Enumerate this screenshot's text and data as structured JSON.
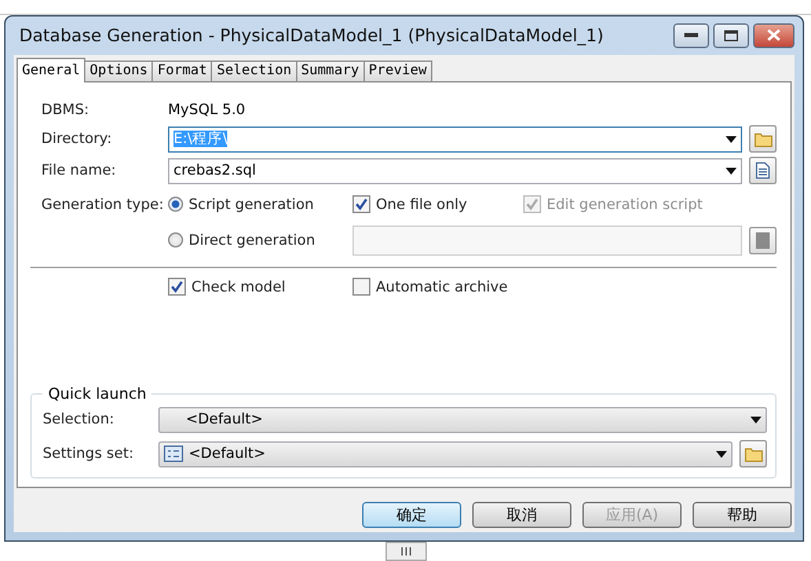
{
  "window": {
    "title": "Database Generation - PhysicalDataModel_1 (PhysicalDataModel_1)"
  },
  "tabs": [
    {
      "label": "General",
      "selected": true
    },
    {
      "label": "Options",
      "selected": false
    },
    {
      "label": "Format",
      "selected": false
    },
    {
      "label": "Selection",
      "selected": false
    },
    {
      "label": "Summary",
      "selected": false
    },
    {
      "label": "Preview",
      "selected": false
    }
  ],
  "dbms": {
    "label": "DBMS:",
    "value": "MySQL 5.0"
  },
  "directory": {
    "label": "Directory:",
    "value": "E:\\程序\\"
  },
  "file_name": {
    "label": "File name:",
    "value": "crebas2.sql"
  },
  "generation_type": {
    "label": "Generation type:",
    "options": [
      {
        "label": "Script generation",
        "selected": true
      },
      {
        "label": "Direct generation",
        "selected": false
      }
    ]
  },
  "script_options": [
    {
      "label": "One file only",
      "checked": true,
      "disabled": false
    },
    {
      "label": "Edit generation script",
      "checked": true,
      "disabled": true
    }
  ],
  "checkboxes": [
    {
      "label": "Check model",
      "checked": true,
      "disabled": false
    },
    {
      "label": "Automatic archive",
      "checked": false,
      "disabled": false
    }
  ],
  "quick_launch": {
    "title": "Quick launch",
    "selection": {
      "label": "Selection:",
      "value": "<Default>"
    },
    "settings_set": {
      "label": "Settings set:",
      "value": "<Default>"
    }
  },
  "buttons": [
    {
      "label": "确定",
      "default": true,
      "disabled": false
    },
    {
      "label": "取消",
      "default": false,
      "disabled": false
    },
    {
      "label": "应用(A)",
      "default": false,
      "disabled": true
    },
    {
      "label": "帮助",
      "default": false,
      "disabled": false
    }
  ]
}
